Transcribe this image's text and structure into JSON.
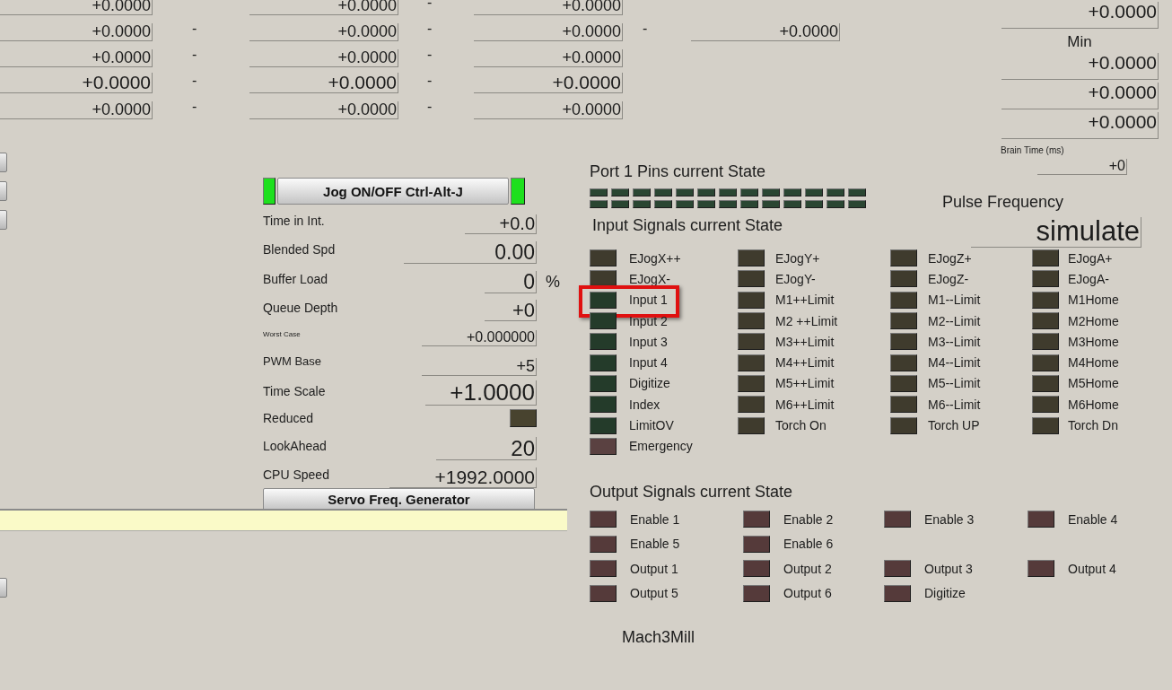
{
  "dro_rows": [
    {
      "large": false,
      "items": [
        {
          "kind": "field",
          "value": "+0.0000"
        },
        {
          "kind": "gap"
        },
        {
          "kind": "field",
          "value": "+0.0000"
        },
        {
          "kind": "dash",
          "value": "-"
        },
        {
          "kind": "field",
          "value": "+0.0000"
        }
      ]
    },
    {
      "large": false,
      "items": [
        {
          "kind": "field",
          "value": "+0.0000"
        },
        {
          "kind": "dash",
          "value": "-"
        },
        {
          "kind": "field",
          "value": "+0.0000"
        },
        {
          "kind": "dash",
          "value": "-"
        },
        {
          "kind": "field",
          "value": "+0.0000"
        },
        {
          "kind": "dash",
          "value": "-"
        },
        {
          "kind": "field",
          "value": "+0.0000"
        }
      ]
    },
    {
      "large": false,
      "items": [
        {
          "kind": "field",
          "value": "+0.0000"
        },
        {
          "kind": "dash",
          "value": "-"
        },
        {
          "kind": "field",
          "value": "+0.0000"
        },
        {
          "kind": "dash",
          "value": "-"
        },
        {
          "kind": "field",
          "value": "+0.0000"
        }
      ]
    },
    {
      "large": true,
      "items": [
        {
          "kind": "field",
          "value": "+0.0000"
        },
        {
          "kind": "dash",
          "value": "-"
        },
        {
          "kind": "field",
          "value": "+0.0000"
        },
        {
          "kind": "dash",
          "value": "-"
        },
        {
          "kind": "field",
          "value": "+0.0000"
        }
      ]
    },
    {
      "large": false,
      "items": [
        {
          "kind": "field",
          "value": "+0.0000"
        },
        {
          "kind": "dash",
          "value": "-"
        },
        {
          "kind": "field",
          "value": "+0.0000"
        },
        {
          "kind": "dash",
          "value": "-"
        },
        {
          "kind": "field",
          "value": "+0.0000"
        }
      ]
    }
  ],
  "right_column": [
    {
      "kind": "field",
      "value": "+0.0000"
    },
    {
      "kind": "label",
      "value": "Min"
    },
    {
      "kind": "field",
      "value": "+0.0000"
    },
    {
      "kind": "field",
      "value": "+0.0000"
    },
    {
      "kind": "field",
      "value": "+0.0000"
    },
    {
      "kind": "caption",
      "value": "Brain Time (ms)"
    },
    {
      "kind": "small_field",
      "value": "+0"
    }
  ],
  "jog_panel": {
    "button": "Jog ON/OFF Ctrl-Alt-J",
    "led_left_on": true,
    "led_right_on": true,
    "rows": [
      {
        "kind": "value",
        "label": "Time in Int.",
        "value": "+0.0"
      },
      {
        "kind": "value",
        "label": "Blended Spd",
        "value": "0.00"
      },
      {
        "kind": "value",
        "label": "Buffer Load",
        "value": "0",
        "unit": "%"
      },
      {
        "kind": "value",
        "label": "Queue Depth",
        "value": "+0"
      },
      {
        "kind": "minor",
        "label": "Worst Case",
        "value": "+0.000000"
      },
      {
        "kind": "value",
        "label": "PWM Base",
        "value": "+5"
      },
      {
        "kind": "value",
        "label": "Time Scale",
        "value": "+1.0000"
      },
      {
        "kind": "led",
        "label": "Reduced",
        "on": false
      },
      {
        "kind": "value",
        "label": "LookAhead",
        "value": "20"
      },
      {
        "kind": "value",
        "label": "CPU Speed",
        "value": "+1992.0000"
      }
    ],
    "footer_button": "Servo Freq. Generator"
  },
  "port_pins": {
    "title": "Port 1 Pins current State",
    "rows": [
      [
        {
          "on": false
        },
        {
          "on": false
        },
        {
          "on": false
        },
        {
          "on": false
        },
        {
          "on": false
        },
        {
          "on": false
        },
        {
          "on": false
        },
        {
          "on": false
        },
        {
          "on": false
        },
        {
          "on": false
        },
        {
          "on": false
        },
        {
          "on": false
        },
        {
          "on": false
        }
      ],
      [
        {
          "on": false
        },
        {
          "on": false
        },
        {
          "on": false
        },
        {
          "on": false
        },
        {
          "on": false
        },
        {
          "on": false
        },
        {
          "on": false
        },
        {
          "on": false
        },
        {
          "on": false
        },
        {
          "on": false
        },
        {
          "on": false
        },
        {
          "on": false
        },
        {
          "on": false
        }
      ]
    ]
  },
  "pulse_frequency": {
    "label": "Pulse Frequency",
    "value": "simulate"
  },
  "input_signals": {
    "title": "Input Signals current State",
    "columns": [
      [
        {
          "label": "EJogX++",
          "color": "#3f3b2d"
        },
        {
          "label": "EJogX-",
          "color": "#3f3b2d"
        },
        {
          "label": "Input 1",
          "color": "#243b2a",
          "highlighted": true
        },
        {
          "label": "Input 2",
          "color": "#243b2a"
        },
        {
          "label": "Input 3",
          "color": "#243b2a"
        },
        {
          "label": "Input 4",
          "color": "#243b2a"
        },
        {
          "label": "Digitize",
          "color": "#243b2a"
        },
        {
          "label": "Index",
          "color": "#243b2a"
        },
        {
          "label": "LimitOV",
          "color": "#243b2a"
        },
        {
          "label": "Emergency",
          "color": "#5a4141"
        }
      ],
      [
        {
          "label": "EJogY+",
          "color": "#3f3b2d"
        },
        {
          "label": "EJogY-",
          "color": "#3f3b2d"
        },
        {
          "label": "M1++Limit",
          "color": "#3f3b2d"
        },
        {
          "label": "M2 ++Limit",
          "color": "#3f3b2d"
        },
        {
          "label": "M3++Limit",
          "color": "#3f3b2d"
        },
        {
          "label": "M4++Limit",
          "color": "#3f3b2d"
        },
        {
          "label": "M5++Limit",
          "color": "#3f3b2d"
        },
        {
          "label": "M6++Limit",
          "color": "#3f3b2d"
        },
        {
          "label": "Torch On",
          "color": "#3f3b2d"
        }
      ],
      [
        {
          "label": "EJogZ+",
          "color": "#3f3b2d"
        },
        {
          "label": "EJogZ-",
          "color": "#3f3b2d"
        },
        {
          "label": "M1--Limit",
          "color": "#3f3b2d"
        },
        {
          "label": "M2--Limit",
          "color": "#3f3b2d"
        },
        {
          "label": "M3--Limit",
          "color": "#3f3b2d"
        },
        {
          "label": "M4--Limit",
          "color": "#3f3b2d"
        },
        {
          "label": "M5--Limit",
          "color": "#3f3b2d"
        },
        {
          "label": "M6--Limit",
          "color": "#3f3b2d"
        },
        {
          "label": "Torch UP",
          "color": "#3f3b2d"
        }
      ],
      [
        {
          "label": "EJogA+",
          "color": "#3f3b2d"
        },
        {
          "label": "EJogA-",
          "color": "#3f3b2d"
        },
        {
          "label": "M1Home",
          "color": "#3f3b2d"
        },
        {
          "label": "M2Home",
          "color": "#3f3b2d"
        },
        {
          "label": "M3Home",
          "color": "#3f3b2d"
        },
        {
          "label": "M4Home",
          "color": "#3f3b2d"
        },
        {
          "label": "M5Home",
          "color": "#3f3b2d"
        },
        {
          "label": "M6Home",
          "color": "#3f3b2d"
        },
        {
          "label": "Torch Dn",
          "color": "#3f3b2d"
        }
      ]
    ]
  },
  "output_signals": {
    "title": "Output Signals current State",
    "rows": [
      [
        {
          "label": "Enable 1",
          "color": "#553a3a"
        },
        {
          "label": "Enable 2",
          "color": "#553a3a"
        },
        {
          "label": "Enable 3",
          "color": "#553a3a"
        },
        {
          "label": "Enable 4",
          "color": "#553a3a"
        }
      ],
      [
        {
          "label": "Enable 5",
          "color": "#553a3a"
        },
        {
          "label": "Enable 6",
          "color": "#553a3a"
        }
      ],
      [
        {
          "label": "Output 1",
          "color": "#553a3a"
        },
        {
          "label": "Output 2",
          "color": "#553a3a"
        },
        {
          "label": "Output 3",
          "color": "#553a3a"
        },
        {
          "label": "Output 4",
          "color": "#553a3a"
        }
      ],
      [
        {
          "label": "Output 5",
          "color": "#553a3a"
        },
        {
          "label": "Output 6",
          "color": "#553a3a"
        },
        {
          "label": "Digitize",
          "color": "#553a3a"
        }
      ]
    ]
  },
  "profile": "Mach3Mill"
}
